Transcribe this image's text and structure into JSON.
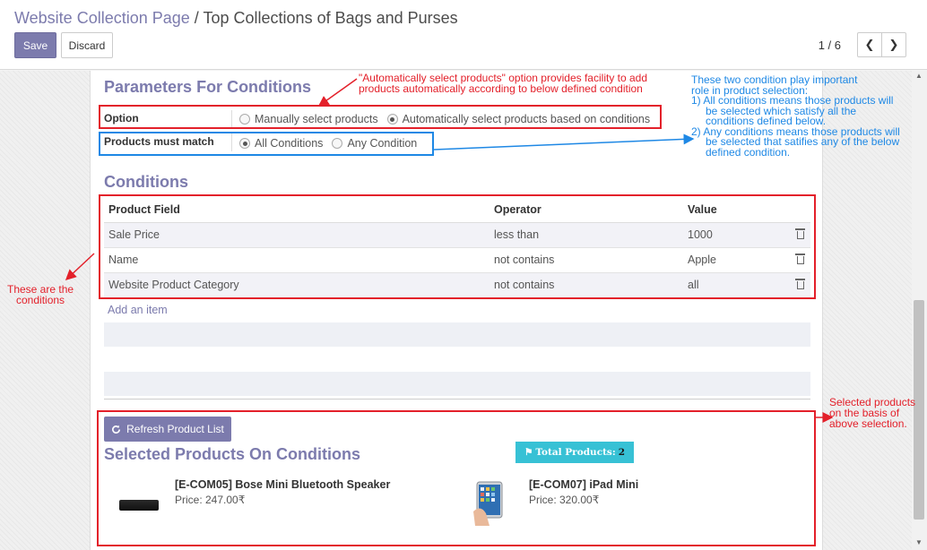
{
  "breadcrumb": {
    "parent": "Website Collection Page",
    "separator": "/",
    "current": "Top Collections of Bags and Purses"
  },
  "toolbar": {
    "save_label": "Save",
    "discard_label": "Discard"
  },
  "pager": {
    "value": "1 / 6",
    "prev_icon": "chevron-left",
    "next_icon": "chevron-right"
  },
  "sections": {
    "params_title": "Parameters For Conditions",
    "conditions_title": "Conditions",
    "selected_title": "Selected Products On Conditions"
  },
  "option": {
    "label": "Option",
    "choices": [
      "Manually select products",
      "Automatically select products based on conditions"
    ],
    "selected_index": 1
  },
  "match": {
    "label": "Products must match",
    "choices": [
      "All Conditions",
      "Any Condition"
    ],
    "selected_index": 0
  },
  "conditions_table": {
    "headers": [
      "Product Field",
      "Operator",
      "Value"
    ],
    "rows": [
      {
        "field": "Sale Price",
        "operator": "less than",
        "value": "1000"
      },
      {
        "field": "Name",
        "operator": "not contains",
        "value": "Apple"
      },
      {
        "field": "Website Product Category",
        "operator": "not contains",
        "value": "all"
      }
    ],
    "add_item": "Add an item",
    "delete_icon": "trash-icon"
  },
  "refresh_button": "Refresh Product List",
  "total_badge": {
    "label": "Total Products:",
    "count": "2"
  },
  "products": [
    {
      "name": "[E-COM05] Bose Mini Bluetooth Speaker",
      "price": "Price: 247.00₹"
    },
    {
      "name": "[E-COM07] iPad Mini",
      "price": "Price: 320.00₹"
    }
  ],
  "annotations": {
    "auto_select": [
      "\"Automatically select products\" option provides facility to add",
      "products automatically according to below defined condition"
    ],
    "two_conditions": [
      "These two condition play important",
      "role in product selection:",
      "1) All conditions means those products will",
      "be selected which satisfy all the",
      "conditions defined below.",
      "2) Any conditions means those products will",
      "be selected that satifies any of the below",
      "defined condition."
    ],
    "these_are": [
      "These are the",
      "conditions"
    ],
    "selected_products": [
      "Selected products",
      "on the basis of",
      "above selection."
    ]
  },
  "colors": {
    "brand": "#7c7bad",
    "annotation_red": "#e3202a",
    "annotation_blue": "#1e88e5",
    "badge": "#37c1d5"
  }
}
